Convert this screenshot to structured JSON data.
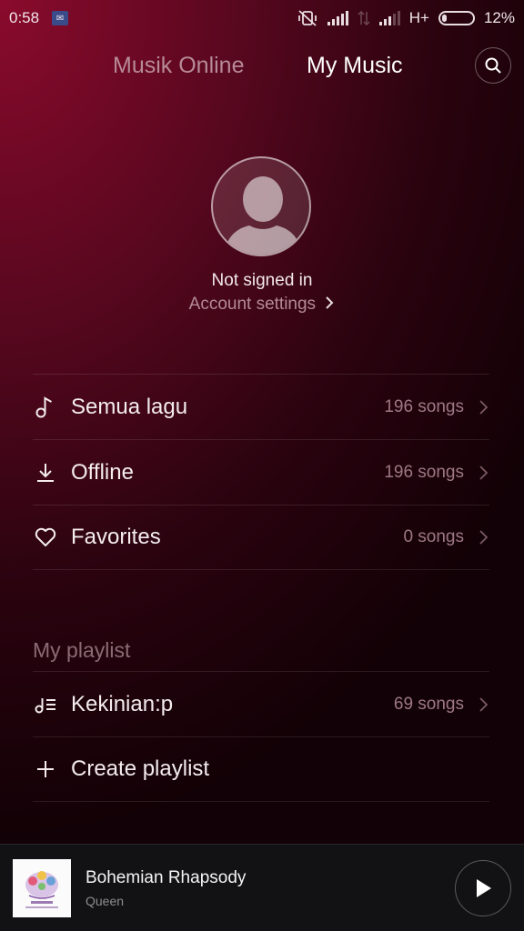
{
  "status_bar": {
    "time": "0:58",
    "network": "H+",
    "battery": "12%"
  },
  "header": {
    "tabs": [
      {
        "label": "Musik Online",
        "active": false
      },
      {
        "label": "My Music",
        "active": true
      }
    ],
    "search_icon": "search-icon"
  },
  "profile": {
    "status": "Not signed in",
    "account_link": "Account settings"
  },
  "library": [
    {
      "icon": "music-note-icon",
      "label": "Semua lagu",
      "count": "196 songs"
    },
    {
      "icon": "download-icon",
      "label": "Offline",
      "count": "196 songs"
    },
    {
      "icon": "heart-icon",
      "label": "Favorites",
      "count": "0 songs"
    }
  ],
  "playlists": {
    "heading": "My playlist",
    "items": [
      {
        "icon": "playlist-icon",
        "label": "Kekinian:p",
        "count": "69 songs"
      }
    ],
    "create_label": "Create playlist"
  },
  "now_playing": {
    "title": "Bohemian Rhapsody",
    "artist": "Queen",
    "state": "paused"
  }
}
